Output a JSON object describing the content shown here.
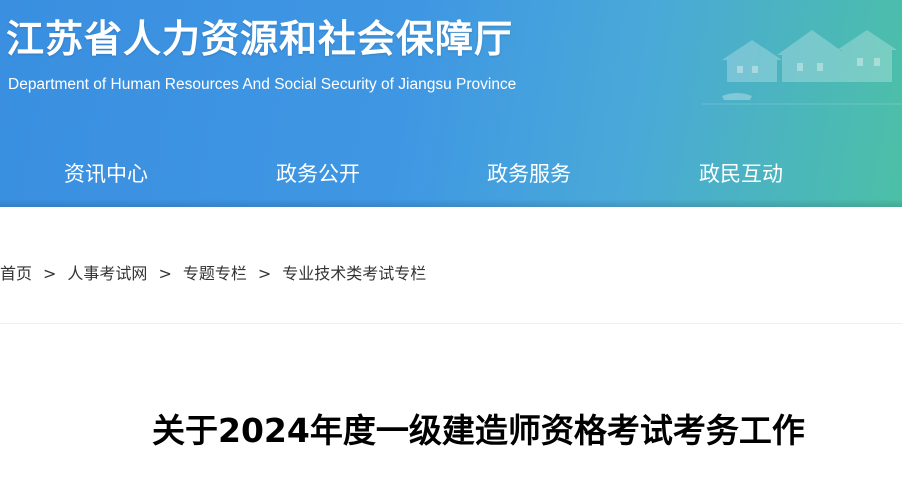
{
  "header": {
    "title": "江苏省人力资源和社会保障厅",
    "subtitle": "Department of Human Resources And Social Security of Jiangsu Province"
  },
  "nav": {
    "items": [
      {
        "label": "资讯中心"
      },
      {
        "label": "政务公开"
      },
      {
        "label": "政务服务"
      },
      {
        "label": "政民互动"
      }
    ]
  },
  "breadcrumb": {
    "items": [
      {
        "label": "首页"
      },
      {
        "label": "人事考试网"
      },
      {
        "label": "专题专栏"
      },
      {
        "label": "专业技术类考试专栏"
      }
    ],
    "separator": ">"
  },
  "article": {
    "title": "关于2024年度一级建造师资格考试考务工作"
  },
  "colors": {
    "header_start": "#3a8fe0",
    "header_end": "#4cc0a6",
    "text": "#333333"
  }
}
